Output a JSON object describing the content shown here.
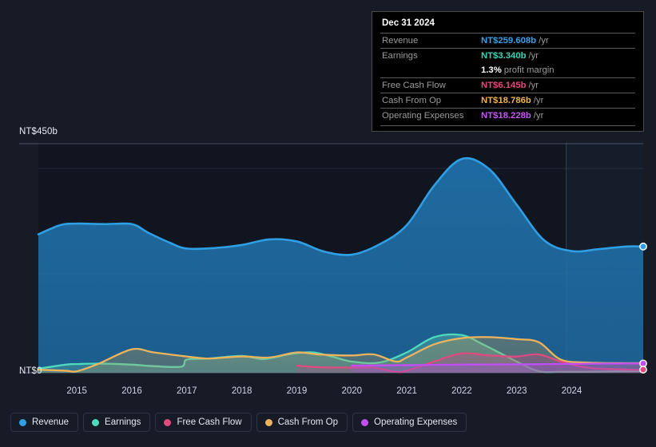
{
  "chart_data": {
    "type": "area",
    "title": "",
    "xlabel": "",
    "ylabel": "",
    "currency_prefix": "NT$",
    "unit_suffix": "b",
    "ylim": [
      0,
      450
    ],
    "y_ticks": [
      {
        "value": 450,
        "label": "NT$450b"
      },
      {
        "value": 0,
        "label": "NT$0"
      }
    ],
    "grid": true,
    "legend_position": "bottom-left",
    "x_tick_labels": [
      "2015",
      "2016",
      "2017",
      "2018",
      "2019",
      "2020",
      "2021",
      "2022",
      "2023",
      "2024"
    ],
    "x_range": [
      2014.3,
      2025.3
    ],
    "forecast_divider_x": 2023.9,
    "series": [
      {
        "name": "Revenue",
        "color": "#2f9fe3",
        "fill": "#1d4f77",
        "x": [
          2014.3,
          2014.7,
          2015.0,
          2015.5,
          2016.0,
          2016.3,
          2016.7,
          2017.0,
          2017.5,
          2018.0,
          2018.5,
          2019.0,
          2019.5,
          2020.0,
          2020.5,
          2021.0,
          2021.5,
          2022.0,
          2022.5,
          2023.0,
          2023.5,
          2024.0,
          2024.5,
          2025.0,
          2025.3
        ],
        "values": [
          272,
          290,
          293,
          292,
          292,
          275,
          255,
          244,
          245,
          251,
          262,
          258,
          238,
          232,
          252,
          290,
          368,
          420,
          400,
          330,
          260,
          239,
          243,
          248,
          248
        ]
      },
      {
        "name": "Earnings",
        "color": "#4fd9bd",
        "fill": "#3d5f5c",
        "x": [
          2014.3,
          2014.8,
          2015.0,
          2015.4,
          2016.0,
          2016.4,
          2016.9,
          2017.0,
          2017.4,
          2018.0,
          2018.4,
          2018.9,
          2019.3,
          2019.7,
          2020.0,
          2020.5,
          2021.0,
          2021.5,
          2022.0,
          2022.4,
          2023.0,
          2023.4,
          2023.8,
          2024.3,
          2025.0,
          2025.3
        ],
        "values": [
          8,
          16,
          17,
          18,
          16,
          13,
          12,
          26,
          28,
          33,
          27,
          37,
          40,
          30,
          22,
          20,
          40,
          70,
          74,
          55,
          22,
          3,
          2,
          2,
          3.34,
          3.34
        ]
      },
      {
        "name": "Free Cash Flow",
        "color": "#e04a80",
        "fill": "#6e3550",
        "start_x": 2019.0,
        "x": [
          2019.0,
          2019.4,
          2020.0,
          2020.4,
          2020.8,
          2021.0,
          2021.5,
          2022.0,
          2022.5,
          2023.0,
          2023.4,
          2023.8,
          2024.3,
          2025.0,
          2025.3
        ],
        "values": [
          14,
          11,
          10,
          10,
          2,
          4,
          22,
          38,
          34,
          32,
          36,
          22,
          10,
          6.145,
          6.145
        ]
      },
      {
        "name": "Cash From Op",
        "color": "#eba košík",
        "values_note": "see cash_from_op"
      },
      {
        "name": "Operating Expenses",
        "color": "#c24df5",
        "fill": "#6a3c8a",
        "start_x": 2020.0,
        "x": [
          2020.0,
          2021.0,
          2022.0,
          2023.0,
          2024.0,
          2025.0,
          2025.3
        ],
        "values": [
          14,
          15,
          16,
          16.5,
          17.5,
          18.228,
          18.228
        ]
      }
    ],
    "cash_from_op": {
      "name": "Cash From Op",
      "color": "#eeb45c",
      "fill": "#5e5742",
      "x": [
        2014.3,
        2014.8,
        2015.0,
        2015.4,
        2016.0,
        2016.4,
        2017.0,
        2017.4,
        2018.0,
        2018.5,
        2019.0,
        2019.4,
        2020.0,
        2020.4,
        2020.8,
        2021.0,
        2021.5,
        2022.0,
        2022.5,
        2023.0,
        2023.4,
        2023.8,
        2024.3,
        2025.0,
        2025.3
      ],
      "values": [
        6,
        4,
        3,
        18,
        46,
        40,
        32,
        28,
        32,
        30,
        40,
        36,
        34,
        36,
        22,
        30,
        56,
        68,
        70,
        66,
        60,
        26,
        20,
        18.786,
        18.786
      ]
    },
    "endpoint_markers": [
      {
        "series": "Revenue",
        "value": 259.608
      },
      {
        "series": "Operating Expenses",
        "value": 18.228
      },
      {
        "series": "Free Cash Flow",
        "value": 6.145
      }
    ]
  },
  "tooltip": {
    "date": "Dec 31 2024",
    "rows": [
      {
        "label": "Revenue",
        "value": "NT$259.608b",
        "unit": "/yr",
        "color": "#3aa0ea"
      },
      {
        "label": "Earnings",
        "value": "NT$3.340b",
        "unit": "/yr",
        "color": "#38d6b4"
      },
      {
        "label": "Free Cash Flow",
        "value": "NT$6.145b",
        "unit": "/yr",
        "color": "#e8477f"
      },
      {
        "label": "Cash From Op",
        "value": "NT$18.786b",
        "unit": "/yr",
        "color": "#f0b44e"
      },
      {
        "label": "Operating Expenses",
        "value": "NT$18.228b",
        "unit": "/yr",
        "color": "#c557f7"
      }
    ],
    "profit_margin_value": "1.3%",
    "profit_margin_text": "profit margin"
  },
  "legend": {
    "items": [
      {
        "label": "Revenue",
        "color": "#2f9fe3"
      },
      {
        "label": "Earnings",
        "color": "#4fd9bd"
      },
      {
        "label": "Free Cash Flow",
        "color": "#e04a80"
      },
      {
        "label": "Cash From Op",
        "color": "#eeb45c"
      },
      {
        "label": "Operating Expenses",
        "color": "#c24df5"
      }
    ]
  },
  "axis": {
    "y_top_label": "NT$450b",
    "y_zero_label": "NT$0",
    "x_ticks": [
      "2015",
      "2016",
      "2017",
      "2018",
      "2019",
      "2020",
      "2021",
      "2022",
      "2023",
      "2024"
    ]
  }
}
